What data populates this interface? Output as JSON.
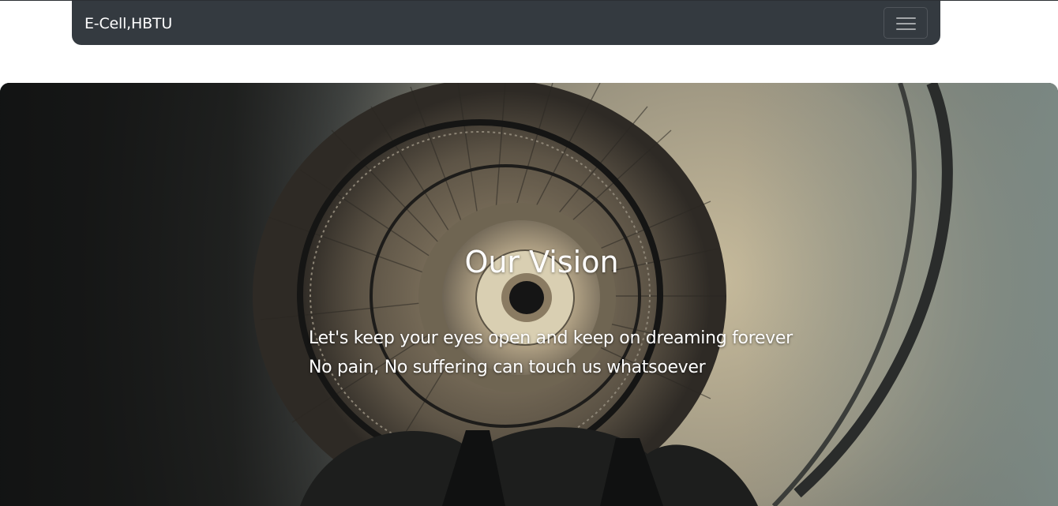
{
  "navbar": {
    "brand": "E-Cell,HBTU",
    "toggle_icon": "hamburger-menu-icon",
    "background_color": "#343a40"
  },
  "hero": {
    "background_image": "spiral-staircase-photo",
    "title": "Our Vision",
    "lines": [
      "Let's keep your eyes open and keep on dreaming forever",
      "No pain, No suffering can touch us whatsoever"
    ],
    "text_color": "#ffffff"
  }
}
